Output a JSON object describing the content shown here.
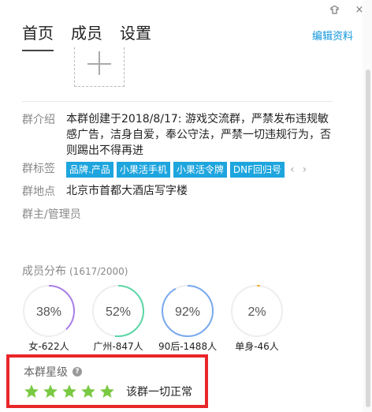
{
  "window": {
    "skin_icon": "skin-icon",
    "close_glyph": "×"
  },
  "tabs": [
    {
      "label": "首页",
      "active": true
    },
    {
      "label": "成员",
      "active": false
    },
    {
      "label": "设置",
      "active": false
    }
  ],
  "edit_profile": "编辑资料",
  "intro": {
    "label": "群介绍",
    "text": "本群创建于2018/8/17:  游戏交流群，严禁发布违规敏感广告，洁身自爱，奉公守法，严禁一切违规行为，否则踢出不得再进"
  },
  "tags": {
    "label": "群标签",
    "items": [
      "品牌.产品",
      "小果活手机",
      "小果活令牌",
      "DNF回归号"
    ]
  },
  "location": {
    "label": "群地点",
    "text": "北京市首都大酒店写字楼"
  },
  "admins": {
    "label": "群主/管理员"
  },
  "distribution": {
    "title": "成员分布",
    "count": "(1617/2000)",
    "items": [
      {
        "percent_label": "38%",
        "percent": 38,
        "label": "女-622人",
        "color": "#a97ee8"
      },
      {
        "percent_label": "52%",
        "percent": 52,
        "label": "广州-847人",
        "color": "#5cd6a6"
      },
      {
        "percent_label": "92%",
        "percent": 92,
        "label": "90后-1488人",
        "color": "#7aa9ee"
      },
      {
        "percent_label": "2%",
        "percent": 2,
        "label": "单身-46人",
        "color": "#f2b233"
      }
    ]
  },
  "rating": {
    "title": "本群星级",
    "help": "?",
    "stars": 5,
    "status": "该群一切正常",
    "star_color": "#7ac943",
    "highlight_color": "#e8262a"
  }
}
